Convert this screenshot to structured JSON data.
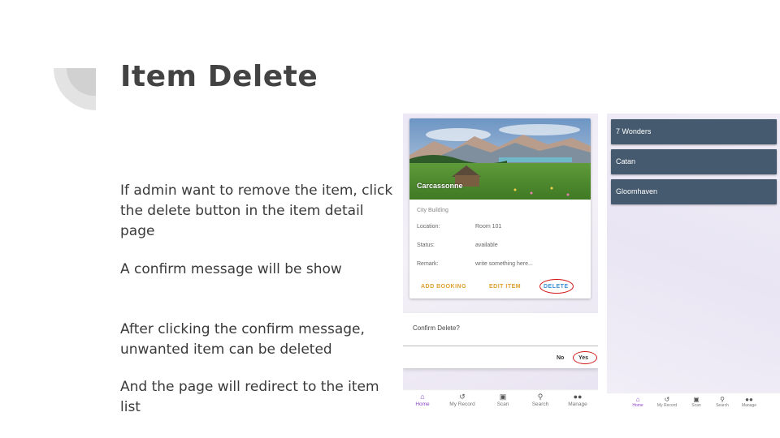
{
  "slide": {
    "title": "Item Delete",
    "paragraphs": [
      "If admin want to remove the item, click the delete button in the item detail page",
      "A confirm message will be show",
      "After clicking the confirm message, unwanted item can be deleted",
      "And the page will redirect to the item list"
    ]
  },
  "screen1": {
    "card": {
      "title": "Carcassonne",
      "category": "City Building",
      "rows": [
        {
          "label": "Location:",
          "value": "Room 101"
        },
        {
          "label": "Status:",
          "value": "available"
        },
        {
          "label": "Remark:",
          "value": "write something here..."
        }
      ],
      "actions": {
        "add_booking": "ADD BOOKING",
        "edit_item": "EDIT ITEM",
        "delete": "DELETE"
      }
    },
    "dialog": {
      "message": "Confirm Delete?",
      "no": "No",
      "yes": "Yes"
    },
    "nav": [
      {
        "label": "Home",
        "icon": "home-icon"
      },
      {
        "label": "My Record",
        "icon": "history-icon"
      },
      {
        "label": "Scan",
        "icon": "scan-icon"
      },
      {
        "label": "Search",
        "icon": "search-icon"
      },
      {
        "label": "Manage",
        "icon": "people-icon"
      }
    ]
  },
  "screen2": {
    "items": [
      "7 Wonders",
      "Catan",
      "Gloomhaven"
    ],
    "nav": [
      {
        "label": "Home",
        "icon": "home-icon"
      },
      {
        "label": "My Record",
        "icon": "history-icon"
      },
      {
        "label": "Scan",
        "icon": "scan-icon"
      },
      {
        "label": "Search",
        "icon": "search-icon"
      },
      {
        "label": "Manage",
        "icon": "people-icon"
      }
    ]
  },
  "colors": {
    "accent": "#8e44c8",
    "highlight_circle": "#d21818",
    "list_item_bg": "#455a6e",
    "action_orange": "#e0a030",
    "action_blue": "#3d8fd8"
  }
}
